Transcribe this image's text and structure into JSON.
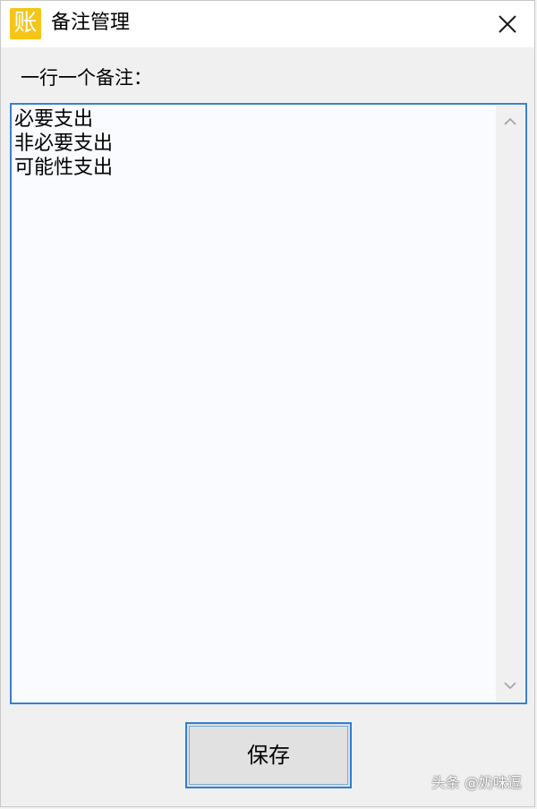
{
  "window": {
    "title": "备注管理",
    "app_icon_char": "账",
    "app_icon_color": "#f5c518"
  },
  "form": {
    "label": "一行一个备注：",
    "notes": [
      "必要支出",
      "非必要支出",
      "可能性支出"
    ],
    "focus_color": "#3a7fd0"
  },
  "buttons": {
    "save_label": "保存"
  },
  "watermark": {
    "text": "头条 @奶味逗"
  },
  "icons": {
    "close": "close-icon",
    "scroll_up": "chevron-up-icon",
    "scroll_down": "chevron-down-icon"
  }
}
